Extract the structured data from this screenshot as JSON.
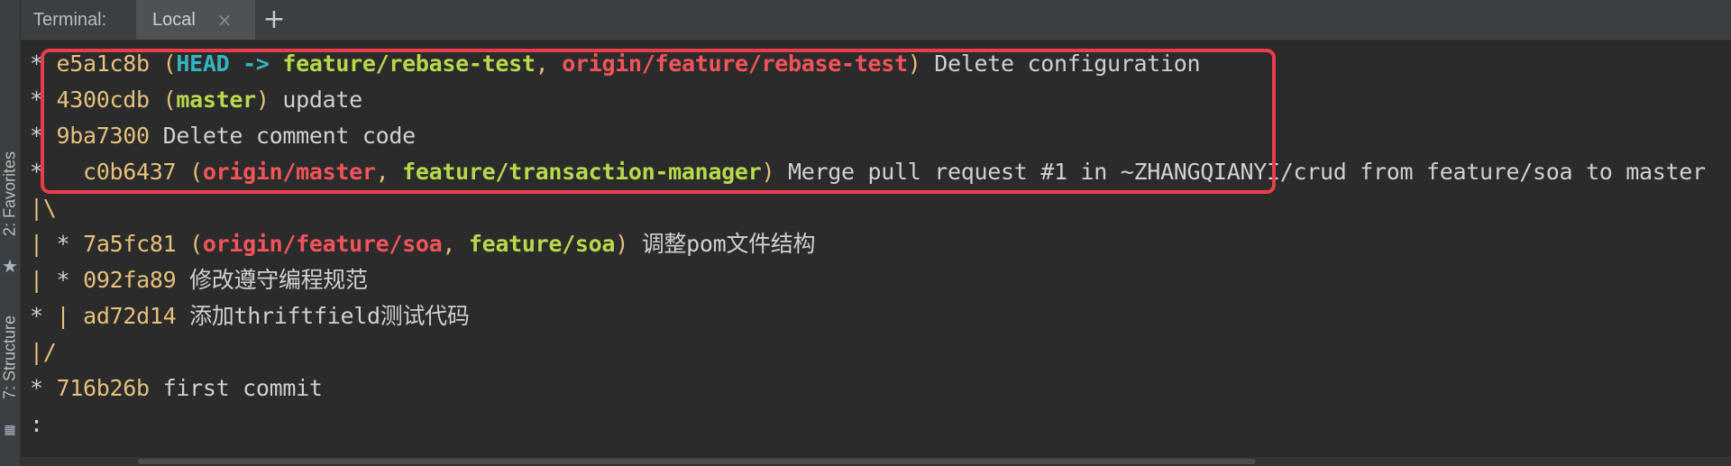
{
  "sidebar": {
    "favorites_label": "2: Favorites",
    "structure_label": "7: Structure",
    "favorites_icon": "star-icon",
    "structure_icon": "structure-icon"
  },
  "tabs": {
    "title": "Terminal:",
    "active_tab": "Local",
    "close_icon": "close-icon",
    "add_icon": "plus-icon"
  },
  "terminal": {
    "lines": [
      {
        "star": "*",
        "hash": "e5a1c8b",
        "open_paren": "(",
        "head": "HEAD",
        "arrow": "->",
        "branch1": "feature/rebase-test",
        "comma": ",",
        "branch2": "origin/feature/rebase-test",
        "close_paren": ")",
        "message": "Delete configuration"
      },
      {
        "star": "*",
        "hash": "4300cdb",
        "open_paren": "(",
        "branch1": "master",
        "close_paren": ")",
        "message": "update"
      },
      {
        "star": "*",
        "hash": "9ba7300",
        "message": "Delete comment code"
      },
      {
        "prefix": "*",
        "hash": "c0b6437",
        "open_paren": "(",
        "branch1": "origin/master",
        "comma": ",",
        "branch2": "feature/transaction-manager",
        "close_paren": ")",
        "message": "Merge pull request #1 in ~ZHANGQIANYI/crud from feature/soa to master"
      },
      {
        "graph": "|\\"
      },
      {
        "graph": "|",
        "star": "*",
        "hash": "7a5fc81",
        "open_paren": "(",
        "branch1": "origin/feature/soa",
        "comma": ",",
        "branch2": "feature/soa",
        "close_paren": ")",
        "message": "调整pom文件结构"
      },
      {
        "graph": "|",
        "star": "*",
        "hash": "092fa89",
        "message": "修改遵守编程规范"
      },
      {
        "star": "*",
        "graph": "|",
        "hash": "ad72d14",
        "message": "添加thriftfield测试代码"
      },
      {
        "graph": "|/"
      },
      {
        "star": "*",
        "hash": "716b26b",
        "message": "first commit"
      },
      {
        "prompt": ":"
      }
    ],
    "highlight_color": "#ea3d4a"
  },
  "colors": {
    "background": "#2b2b2b",
    "toolbar": "#3c3f41",
    "hash": "#e5c07b",
    "local_branch": "#b7d94a",
    "remote_branch": "#f2545b",
    "head": "#33b5c1"
  }
}
